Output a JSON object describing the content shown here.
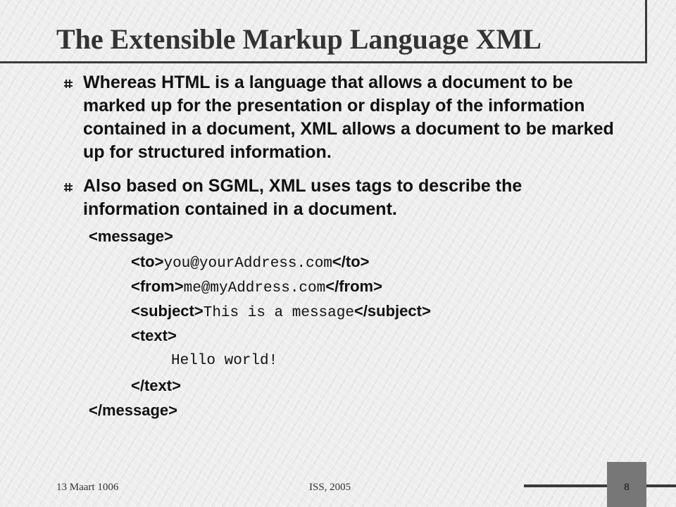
{
  "slide": {
    "title": "The Extensible Markup Language XML",
    "bullets": [
      "Whereas HTML is a language that allows a document to be marked up for the presentation or display of the information contained in a document, XML allows a document to be marked up for structured information.",
      "Also based on SGML, XML uses tags to describe the information contained in a document."
    ],
    "code": {
      "message_open": "<message>",
      "to_open": "<to>",
      "to_value": "you@yourAddress.com",
      "to_close": "</to>",
      "from_open": "<from>",
      "from_value": "me@myAddress.com",
      "from_close": "</from>",
      "subject_open": "<subject>",
      "subject_value": "This is a message",
      "subject_close": "</subject>",
      "text_open": "<text>",
      "text_value": "Hello world!",
      "text_close": "</text>",
      "message_close": "</message>"
    }
  },
  "footer": {
    "date": "13 Maart 1006",
    "center": "ISS, 2005",
    "page": "8"
  },
  "colors": {
    "rule": "#3a3a3a",
    "page_box": "#777777",
    "title": "#333333"
  }
}
